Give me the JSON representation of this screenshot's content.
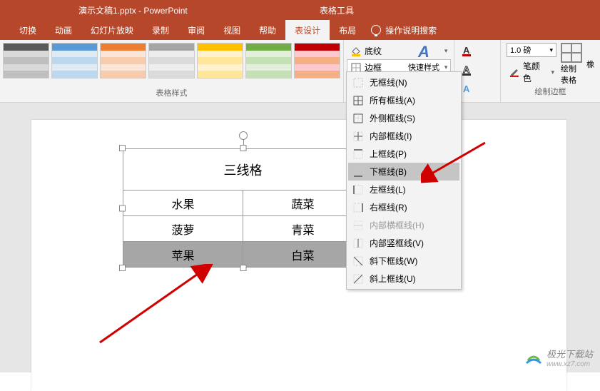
{
  "titlebar": {
    "text": "演示文稿1.pptx - PowerPoint"
  },
  "tool_tab_title": "表格工具",
  "tabs": {
    "items": [
      "切换",
      "动画",
      "幻灯片放映",
      "录制",
      "审阅",
      "视图",
      "帮助",
      "表设计",
      "布局"
    ],
    "active_index": 7,
    "help_search": "操作说明搜索"
  },
  "groups": {
    "table_styles": "表格样式",
    "draw_borders": "绘制边框"
  },
  "border_controls": {
    "shading": "底纹",
    "border": "边框",
    "quick_style": "快速样式",
    "pen_color": "笔颜色",
    "pen_width": "1.0 磅",
    "draw_table": "绘制表格"
  },
  "dropdown": {
    "items": [
      {
        "label": "无框线(N)",
        "hover": false
      },
      {
        "label": "所有框线(A)",
        "hover": false
      },
      {
        "label": "外侧框线(S)",
        "hover": false
      },
      {
        "label": "内部框线(I)",
        "hover": false
      },
      {
        "label": "上框线(P)",
        "hover": false
      },
      {
        "label": "下框线(B)",
        "hover": true
      },
      {
        "label": "左框线(L)",
        "hover": false
      },
      {
        "label": "右框线(R)",
        "hover": false
      },
      {
        "label": "内部横框线(H)",
        "hover": false,
        "disabled": true
      },
      {
        "label": "内部竖框线(V)",
        "hover": false
      },
      {
        "label": "斜下框线(W)",
        "hover": false
      },
      {
        "label": "斜上框线(U)",
        "hover": false
      }
    ]
  },
  "table": {
    "title": "三线格",
    "cols": [
      "水果",
      "蔬菜"
    ],
    "rows": [
      [
        "菠萝",
        "青菜"
      ],
      [
        "苹果",
        "白菜"
      ]
    ],
    "selected_row": 1
  },
  "watermark": {
    "name": "极光下载站",
    "url": "www.xz7.com"
  }
}
